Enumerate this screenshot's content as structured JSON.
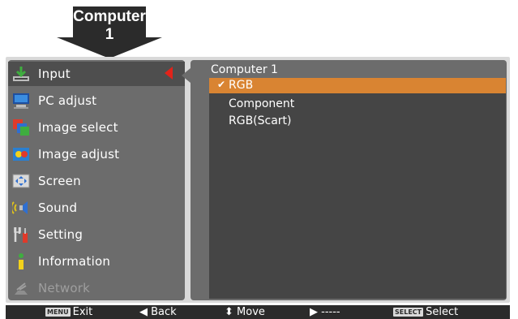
{
  "badge": {
    "line1": "Computer",
    "line2": "1"
  },
  "menu": {
    "items": [
      {
        "label": "Input",
        "icon": "input-icon"
      },
      {
        "label": "PC adjust",
        "icon": "pc-adjust-icon"
      },
      {
        "label": "Image select",
        "icon": "image-select-icon"
      },
      {
        "label": "Image adjust",
        "icon": "image-adjust-icon"
      },
      {
        "label": "Screen",
        "icon": "screen-icon"
      },
      {
        "label": "Sound",
        "icon": "sound-icon"
      },
      {
        "label": "Setting",
        "icon": "setting-icon"
      },
      {
        "label": "Information",
        "icon": "information-icon"
      },
      {
        "label": "Network",
        "icon": "network-icon"
      }
    ]
  },
  "pane": {
    "title": "Computer 1",
    "options": [
      "RGB",
      "Component",
      "RGB(Scart)"
    ],
    "check": "✔"
  },
  "bottom_bar": {
    "exit_key": "MENU",
    "exit_label": "Exit",
    "back_label": "◀ Back",
    "move_label": "⬍ Move",
    "next_label": "▶ -----",
    "select_key": "SELECT",
    "select_label": "Select"
  },
  "colors": {
    "highlight": "#d98432",
    "accent_red": "#e2231a",
    "panel": "#6c6c6c",
    "list": "#454545"
  }
}
